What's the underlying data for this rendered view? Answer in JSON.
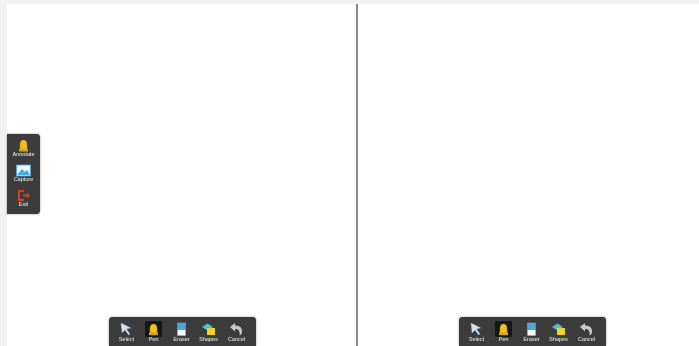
{
  "side_toolbar": {
    "items": [
      {
        "label": "Annotate",
        "icon": "highlighter-icon"
      },
      {
        "label": "Capture",
        "icon": "picture-icon"
      },
      {
        "label": "Exit",
        "icon": "exit-icon"
      }
    ]
  },
  "toolbars": [
    {
      "tools": [
        {
          "label": "Select",
          "icon": "cursor-icon"
        },
        {
          "label": "Pen",
          "icon": "pen-icon",
          "active": true
        },
        {
          "label": "Eraser",
          "icon": "eraser-icon"
        },
        {
          "label": "Shapes",
          "icon": "shapes-icon"
        },
        {
          "label": "Cancel",
          "icon": "undo-icon"
        }
      ]
    },
    {
      "tools": [
        {
          "label": "Select",
          "icon": "cursor-icon"
        },
        {
          "label": "Pen",
          "icon": "pen-icon",
          "active": true
        },
        {
          "label": "Eraser",
          "icon": "eraser-icon"
        },
        {
          "label": "Shapes",
          "icon": "shapes-icon"
        },
        {
          "label": "Cancel",
          "icon": "undo-icon"
        }
      ]
    }
  ],
  "colors": {
    "toolbar_bg": "#3c3c3c",
    "active_bg": "#161616",
    "pen_yellow": "#f0c020",
    "exit_red": "#e03a1e",
    "capture_blue": "#4aa8e0",
    "divider": "#8a8a8a"
  }
}
